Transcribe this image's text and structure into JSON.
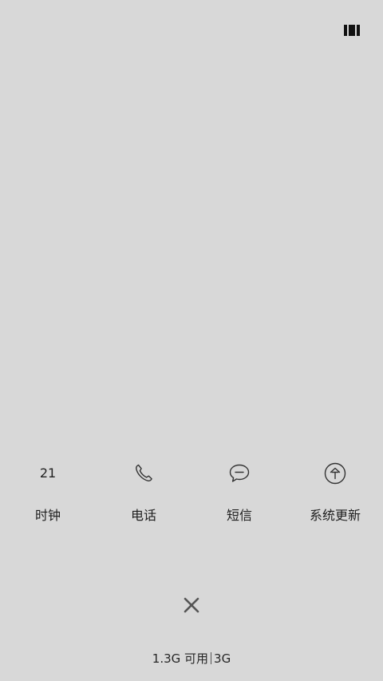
{
  "top_right_icon": "recent-apps-icon",
  "apps": [
    {
      "id": "clock",
      "label": "时钟",
      "icon_text": "21",
      "icon": "clock-date-icon"
    },
    {
      "id": "phone",
      "label": "电话",
      "icon": "phone-icon"
    },
    {
      "id": "sms",
      "label": "短信",
      "icon": "message-bubble-icon"
    },
    {
      "id": "system-update",
      "label": "系统更新",
      "icon": "arrow-up-circle-icon"
    }
  ],
  "close_icon": "close-icon",
  "memory": {
    "available": "1.3G 可用",
    "total": "3G"
  }
}
